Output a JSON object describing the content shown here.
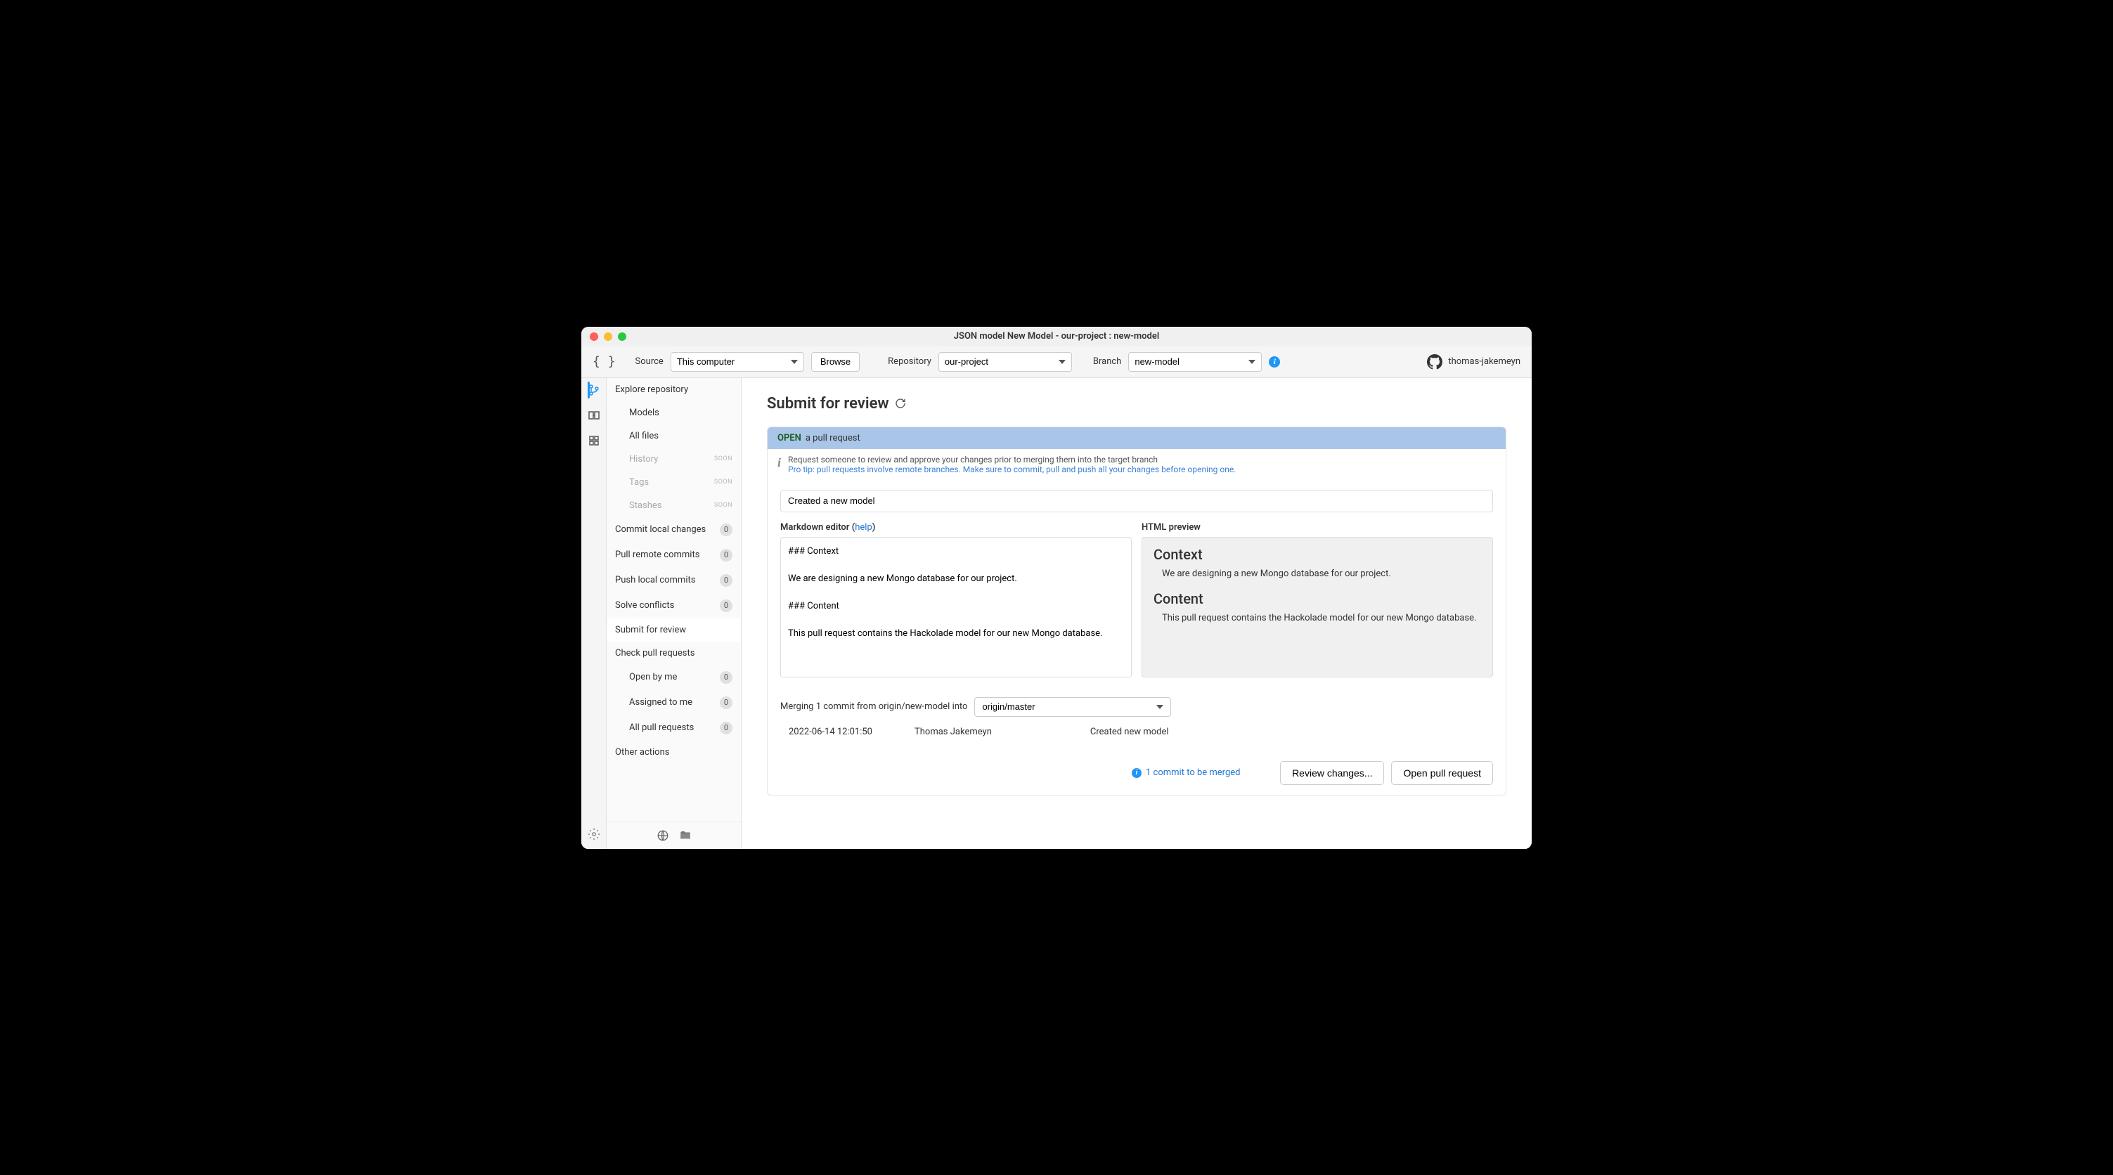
{
  "window": {
    "title": "JSON model New Model - our-project : new-model"
  },
  "toolbar": {
    "source_label": "Source",
    "source_value": "This computer",
    "browse": "Browse",
    "repo_label": "Repository",
    "repo_value": "our-project",
    "branch_label": "Branch",
    "branch_value": "new-model",
    "username": "thomas-jakemeyn"
  },
  "sidebar": {
    "explore": "Explore repository",
    "models": "Models",
    "allfiles": "All files",
    "history": "History",
    "tags": "Tags",
    "stashes": "Stashes",
    "soon": "SOON",
    "commit": "Commit local changes",
    "commit_n": "0",
    "pull": "Pull remote commits",
    "pull_n": "0",
    "push": "Push local commits",
    "push_n": "0",
    "solve": "Solve conflicts",
    "solve_n": "0",
    "submit": "Submit for review",
    "check": "Check pull requests",
    "openbyme": "Open by me",
    "openbyme_n": "0",
    "assigned": "Assigned to me",
    "assigned_n": "0",
    "allpr": "All pull requests",
    "allpr_n": "0",
    "other": "Other actions"
  },
  "main": {
    "title": "Submit for review",
    "panel_open": "OPEN",
    "panel_suffix": "a pull request",
    "info_line1": "Request someone to review and approve your changes prior to merging them into the target branch",
    "info_protip": "Pro tip: pull requests involve remote branches. Make sure to commit, pull and push all your changes before opening one.",
    "pr_title": "Created a new model",
    "md_label_prefix": "Markdown editor (",
    "md_help": "help",
    "md_label_suffix": ")",
    "preview_label": "HTML preview",
    "md_text": "### Context\n\nWe are designing a new Mongo database for our project.\n\n### Content\n\nThis pull request contains the Hackolade model for our new Mongo database.",
    "preview_h1": "Context",
    "preview_p1": "We are designing a new Mongo database for our project.",
    "preview_h2": "Content",
    "preview_p2": "This pull request contains the Hackolade model for our new Mongo database.",
    "merge_text": "Merging 1 commit from origin/new-model into",
    "merge_target": "origin/master",
    "commit_date": "2022-06-14 12:01:50",
    "commit_author": "Thomas Jakemeyn",
    "commit_msg": "Created new model",
    "footer_info": "1 commit to be merged",
    "btn_review": "Review changes...",
    "btn_open": "Open pull request"
  }
}
